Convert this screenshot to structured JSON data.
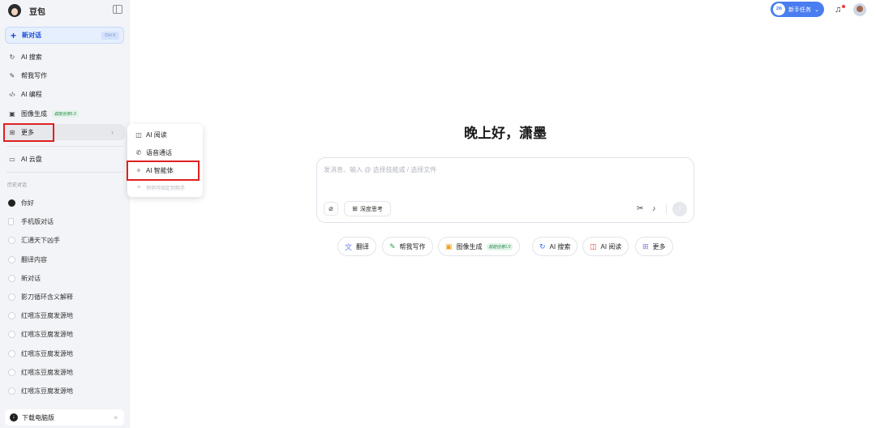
{
  "app": {
    "name": "豆包"
  },
  "sidebar": {
    "new_chat": {
      "label": "新对话",
      "shortcut": "Ctrl K"
    },
    "nav": [
      {
        "icon": "ai-search-icon",
        "label": "AI 搜索"
      },
      {
        "icon": "write-icon",
        "label": "帮我写作"
      },
      {
        "icon": "code-icon",
        "label": "AI 编程"
      },
      {
        "icon": "image-icon",
        "label": "图像生成",
        "tag": "超能创意1.0"
      },
      {
        "icon": "grid-icon",
        "label": "更多"
      },
      {
        "icon": "cloud-disk-icon",
        "label": "AI 云盘"
      }
    ],
    "history_title": "历史对话",
    "history": [
      "你好",
      "手机版对话",
      "汇通天下凶手",
      "翻译内容",
      "新对话",
      "影刀循环含义解释",
      "红喂冻豆腐发源地",
      "红喂冻豆腐发源地",
      "红喂冻豆腐发源地",
      "红喂冻豆腐发源地",
      "红喂冻豆腐发源地"
    ],
    "download_label": "下载电脑版"
  },
  "more_menu": {
    "items": [
      {
        "icon": "ai-read-icon",
        "label": "AI 阅读"
      },
      {
        "icon": "phone-icon",
        "label": "语音通话"
      },
      {
        "icon": "sparkle-icon",
        "label": "AI 智能体"
      }
    ],
    "hint": "悄悄可固定到侧手"
  },
  "header": {
    "task_badge": "2/6",
    "task_label": "新手任务"
  },
  "main": {
    "greeting": "晚上好，潇墨",
    "input_placeholder": "发消息、输入 @ 选择技能或 / 选择文件",
    "deep_think_label": "深度思考",
    "chips": [
      {
        "icon": "translate-icon",
        "label": "翻译"
      },
      {
        "icon": "write-icon",
        "label": "帮我写作"
      },
      {
        "icon": "image-icon",
        "label": "图像生成",
        "tag": "超能创意1.0"
      },
      {
        "icon": "ai-search-icon",
        "label": "AI 搜索"
      },
      {
        "icon": "ai-read-icon",
        "label": "AI 阅读"
      },
      {
        "icon": "grid-icon",
        "label": "更多"
      }
    ]
  }
}
